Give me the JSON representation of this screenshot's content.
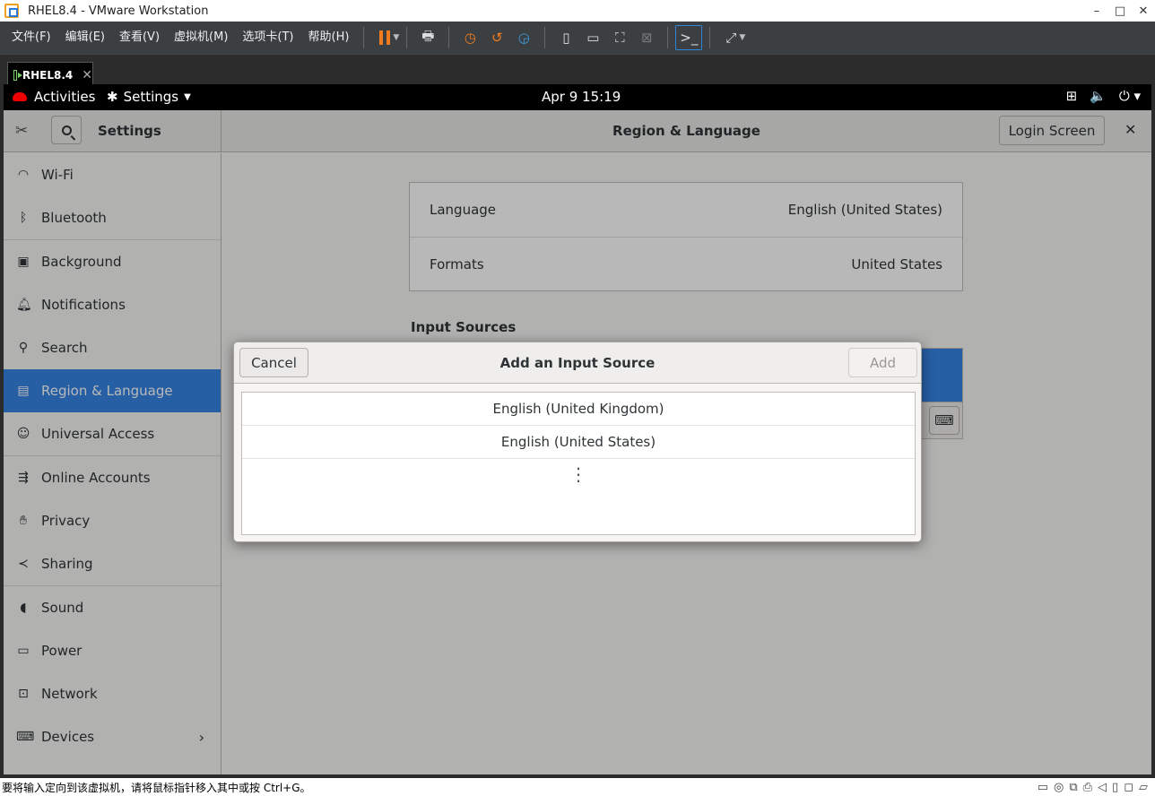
{
  "vmware": {
    "window_title": "RHEL8.4 - VMware Workstation",
    "window_buttons": [
      "–",
      "□",
      "✕"
    ],
    "menu": [
      "文件(F)",
      "编辑(E)",
      "查看(V)",
      "虚拟机(M)",
      "选项卡(T)",
      "帮助(H)"
    ],
    "tab_label": "RHEL8.4",
    "tab_close": "✕",
    "status_message": "要将输入定向到该虚拟机，请将鼠标指针移入其中或按 Ctrl+G。"
  },
  "gnome": {
    "activities": "Activities",
    "app_menu": "Settings",
    "clock": "Apr 9  15:19"
  },
  "settings": {
    "sidebar_title": "Settings",
    "panel_title": "Region & Language",
    "login_screen_button": "Login Screen",
    "sidebar": [
      {
        "label": "Wi-Fi",
        "icon": "wifi-icon"
      },
      {
        "label": "Bluetooth",
        "icon": "bluetooth-icon"
      },
      {
        "label": "Background",
        "icon": "background-icon"
      },
      {
        "label": "Notifications",
        "icon": "bell-icon"
      },
      {
        "label": "Search",
        "icon": "search-icon"
      },
      {
        "label": "Region & Language",
        "icon": "region-icon",
        "selected": true
      },
      {
        "label": "Universal Access",
        "icon": "accessibility-icon"
      },
      {
        "label": "Online Accounts",
        "icon": "online-accounts-icon"
      },
      {
        "label": "Privacy",
        "icon": "hand-icon"
      },
      {
        "label": "Sharing",
        "icon": "share-icon"
      },
      {
        "label": "Sound",
        "icon": "speaker-icon"
      },
      {
        "label": "Power",
        "icon": "power-icon"
      },
      {
        "label": "Network",
        "icon": "network-icon"
      },
      {
        "label": "Devices",
        "icon": "devices-icon"
      }
    ],
    "language": {
      "label": "Language",
      "value": "English (United States)"
    },
    "formats": {
      "label": "Formats",
      "value": "United States"
    },
    "input_sources_heading": "Input Sources"
  },
  "dialog": {
    "title": "Add an Input Source",
    "cancel": "Cancel",
    "add": "Add",
    "options": [
      "English (United Kingdom)",
      "English (United States)"
    ],
    "more": "⋮"
  }
}
